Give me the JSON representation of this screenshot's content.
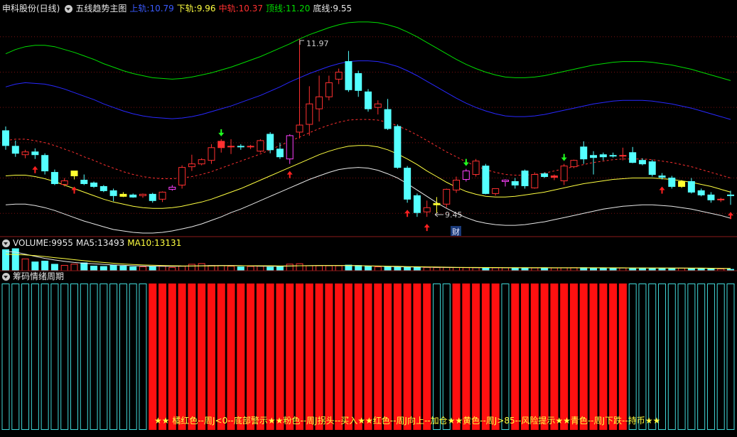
{
  "header_main": {
    "stock": "申科股份(日线)",
    "indicator": "五线趋势主图",
    "upper_label": "上轨:",
    "upper_value": "10.79",
    "lower_label": "下轨:",
    "lower_value": "9.96",
    "mid_label": "中轨:",
    "mid_value": "10.37",
    "top_label": "顶线:",
    "top_value": "11.20",
    "bottom_label": "底线:",
    "bottom_value": "9.55"
  },
  "header_volume": {
    "vol_label": "VOLUME:",
    "vol_value": "9955",
    "ma5_label": "MA5:",
    "ma5_value": "13493",
    "ma10_label": "MA10:",
    "ma10_value": "13131"
  },
  "header_chip": {
    "title": "筹码情绪周期"
  },
  "annotations": {
    "high": "11.97",
    "low": "9.45",
    "cai": "财"
  },
  "legend_text": "★★ 橘红色--周J<0--底部警示★★粉色--周J拐头--买入★★红色--周J向上--加仓★★黄色--周J>85--风险提示★★青色--周J下跌--持币★★",
  "colors": {
    "up": "#ff3030",
    "down": "#54ffff",
    "top_line": "#00dd00",
    "upper_line": "#2828ff",
    "mid_line": "#ff3030",
    "lower_line": "#ffff40",
    "bottom_line": "#e8e8e8"
  },
  "chart_data": {
    "type": "candlestick",
    "price_ylim": [
      9.2,
      12.3
    ],
    "candles": [
      {
        "o": 10.67,
        "h": 10.73,
        "l": 10.4,
        "c": 10.46,
        "mark": "down"
      },
      {
        "o": 10.45,
        "h": 10.53,
        "l": 10.3,
        "c": 10.35,
        "mark": "down"
      },
      {
        "o": 10.33,
        "h": 10.4,
        "l": 10.28,
        "c": 10.37,
        "mark": "up"
      },
      {
        "o": 10.37,
        "h": 10.42,
        "l": 10.27,
        "c": 10.33,
        "mark": "down"
      },
      {
        "o": 10.32,
        "h": 10.35,
        "l": 10.05,
        "c": 10.1,
        "mark": "down"
      },
      {
        "o": 10.08,
        "h": 10.12,
        "l": 9.9,
        "c": 9.92,
        "mark": "down"
      },
      {
        "o": 9.91,
        "h": 10.0,
        "l": 9.88,
        "c": 9.96,
        "mark": "up"
      },
      {
        "o": 10.03,
        "h": 10.1,
        "l": 9.98,
        "c": 10.1,
        "mark": "yellow"
      },
      {
        "o": 9.97,
        "h": 10.05,
        "l": 9.9,
        "c": 9.92,
        "mark": "down"
      },
      {
        "o": 9.93,
        "h": 9.95,
        "l": 9.86,
        "c": 9.88,
        "mark": "down"
      },
      {
        "o": 9.88,
        "h": 9.9,
        "l": 9.8,
        "c": 9.82,
        "mark": "down"
      },
      {
        "o": 9.82,
        "h": 9.85,
        "l": 9.67,
        "c": 9.75,
        "mark": "down"
      },
      {
        "o": 9.77,
        "h": 9.8,
        "l": 9.73,
        "c": 9.74,
        "mark": "yellow"
      },
      {
        "o": 9.76,
        "h": 9.78,
        "l": 9.72,
        "c": 9.73,
        "mark": "down"
      },
      {
        "o": 9.75,
        "h": 9.78,
        "l": 9.72,
        "c": 9.77,
        "mark": "up"
      },
      {
        "o": 9.77,
        "h": 9.79,
        "l": 9.65,
        "c": 9.68,
        "mark": "down"
      },
      {
        "o": 9.7,
        "h": 9.81,
        "l": 9.66,
        "c": 9.8,
        "mark": "up"
      },
      {
        "o": 9.84,
        "h": 9.9,
        "l": 9.82,
        "c": 9.87,
        "mark": "pink"
      },
      {
        "o": 9.9,
        "h": 10.18,
        "l": 9.85,
        "c": 10.15,
        "mark": "up"
      },
      {
        "o": 10.16,
        "h": 10.33,
        "l": 10.1,
        "c": 10.2,
        "mark": "up"
      },
      {
        "o": 10.2,
        "h": 10.28,
        "l": 10.18,
        "c": 10.26,
        "mark": "up"
      },
      {
        "o": 10.25,
        "h": 10.48,
        "l": 10.2,
        "c": 10.43,
        "mark": "up"
      },
      {
        "o": 10.43,
        "h": 10.55,
        "l": 10.36,
        "c": 10.52,
        "mark": "down"
      },
      {
        "o": 10.44,
        "h": 10.55,
        "l": 10.34,
        "c": 10.45,
        "mark": "up"
      },
      {
        "o": 10.45,
        "h": 10.48,
        "l": 10.4,
        "c": 10.44,
        "mark": "down"
      },
      {
        "o": 10.44,
        "h": 10.47,
        "l": 10.41,
        "c": 10.45,
        "mark": "up"
      },
      {
        "o": 10.38,
        "h": 10.55,
        "l": 10.36,
        "c": 10.53,
        "mark": "up"
      },
      {
        "o": 10.62,
        "h": 10.65,
        "l": 10.35,
        "c": 10.4,
        "mark": "down"
      },
      {
        "o": 10.41,
        "h": 10.5,
        "l": 10.27,
        "c": 10.3,
        "mark": "down"
      },
      {
        "o": 10.27,
        "h": 10.62,
        "l": 10.2,
        "c": 10.6,
        "mark": "pink"
      },
      {
        "o": 10.65,
        "h": 11.97,
        "l": 10.56,
        "c": 10.75,
        "mark": "up"
      },
      {
        "o": 10.76,
        "h": 11.3,
        "l": 10.6,
        "c": 11.05,
        "mark": "up"
      },
      {
        "o": 10.98,
        "h": 11.45,
        "l": 10.8,
        "c": 11.15,
        "mark": "up"
      },
      {
        "o": 11.15,
        "h": 11.45,
        "l": 11.1,
        "c": 11.35,
        "mark": "up"
      },
      {
        "o": 11.4,
        "h": 11.55,
        "l": 11.33,
        "c": 11.5,
        "mark": "up"
      },
      {
        "o": 11.65,
        "h": 11.8,
        "l": 11.22,
        "c": 11.25,
        "mark": "down"
      },
      {
        "o": 11.48,
        "h": 11.52,
        "l": 11.15,
        "c": 11.24,
        "mark": "down"
      },
      {
        "o": 11.22,
        "h": 11.26,
        "l": 10.94,
        "c": 10.98,
        "mark": "down"
      },
      {
        "o": 11.0,
        "h": 11.1,
        "l": 10.9,
        "c": 11.05,
        "mark": "up"
      },
      {
        "o": 10.97,
        "h": 11.12,
        "l": 10.68,
        "c": 10.7,
        "mark": "down"
      },
      {
        "o": 10.73,
        "h": 10.76,
        "l": 10.13,
        "c": 10.15,
        "mark": "down"
      },
      {
        "o": 10.14,
        "h": 10.17,
        "l": 9.65,
        "c": 9.7,
        "mark": "down"
      },
      {
        "o": 9.75,
        "h": 9.78,
        "l": 9.45,
        "c": 9.51,
        "mark": "down"
      },
      {
        "o": 9.52,
        "h": 9.68,
        "l": 9.45,
        "c": 9.58,
        "mark": "up"
      },
      {
        "o": 9.62,
        "h": 9.73,
        "l": 9.5,
        "c": 9.64,
        "mark": "yellow"
      },
      {
        "o": 9.63,
        "h": 9.85,
        "l": 9.58,
        "c": 9.84,
        "mark": "up"
      },
      {
        "o": 9.83,
        "h": 10.02,
        "l": 9.79,
        "c": 9.97,
        "mark": "up"
      },
      {
        "o": 9.98,
        "h": 10.13,
        "l": 9.95,
        "c": 10.1,
        "mark": "pink"
      },
      {
        "o": 10.05,
        "h": 10.27,
        "l": 10.02,
        "c": 10.24,
        "mark": "up"
      },
      {
        "o": 10.17,
        "h": 10.2,
        "l": 9.77,
        "c": 9.78,
        "mark": "down"
      },
      {
        "o": 9.78,
        "h": 9.85,
        "l": 9.75,
        "c": 9.85,
        "mark": "up"
      },
      {
        "o": 9.95,
        "h": 9.98,
        "l": 9.88,
        "c": 9.97,
        "mark": "pink"
      },
      {
        "o": 9.95,
        "h": 10.0,
        "l": 9.85,
        "c": 9.9,
        "mark": "down"
      },
      {
        "o": 10.1,
        "h": 10.12,
        "l": 9.85,
        "c": 9.89,
        "mark": "down"
      },
      {
        "o": 9.86,
        "h": 10.08,
        "l": 9.85,
        "c": 10.05,
        "mark": "up"
      },
      {
        "o": 10.06,
        "h": 10.08,
        "l": 10.0,
        "c": 10.02,
        "mark": "down"
      },
      {
        "o": 10.01,
        "h": 10.05,
        "l": 9.97,
        "c": 10.03,
        "mark": "down"
      },
      {
        "o": 9.96,
        "h": 10.2,
        "l": 9.9,
        "c": 10.17,
        "mark": "up"
      },
      {
        "o": 10.16,
        "h": 10.26,
        "l": 10.14,
        "c": 10.25,
        "mark": "up"
      },
      {
        "o": 10.44,
        "h": 10.52,
        "l": 10.2,
        "c": 10.27,
        "mark": "down"
      },
      {
        "o": 10.32,
        "h": 10.38,
        "l": 10.05,
        "c": 10.29,
        "mark": "down"
      },
      {
        "o": 10.33,
        "h": 10.36,
        "l": 10.25,
        "c": 10.3,
        "mark": "down"
      },
      {
        "o": 10.32,
        "h": 10.36,
        "l": 10.29,
        "c": 10.31,
        "mark": "down"
      },
      {
        "o": 10.32,
        "h": 10.43,
        "l": 10.25,
        "c": 10.32,
        "mark": "up"
      },
      {
        "o": 10.36,
        "h": 10.44,
        "l": 10.21,
        "c": 10.22,
        "mark": "down"
      },
      {
        "o": 10.25,
        "h": 10.28,
        "l": 10.18,
        "c": 10.2,
        "mark": "down"
      },
      {
        "o": 10.23,
        "h": 10.26,
        "l": 10.02,
        "c": 10.05,
        "mark": "down"
      },
      {
        "o": 10.03,
        "h": 10.07,
        "l": 9.98,
        "c": 10.01,
        "mark": "down"
      },
      {
        "o": 10.0,
        "h": 10.03,
        "l": 9.85,
        "c": 9.88,
        "mark": "down"
      },
      {
        "o": 9.88,
        "h": 9.97,
        "l": 9.86,
        "c": 9.95,
        "mark": "yellow"
      },
      {
        "o": 9.95,
        "h": 10.0,
        "l": 9.78,
        "c": 9.8,
        "mark": "down"
      },
      {
        "o": 9.82,
        "h": 9.85,
        "l": 9.74,
        "c": 9.76,
        "mark": "down"
      },
      {
        "o": 9.76,
        "h": 9.8,
        "l": 9.65,
        "c": 9.69,
        "mark": "down"
      },
      {
        "o": 9.69,
        "h": 9.72,
        "l": 9.66,
        "c": 9.7,
        "mark": "up"
      },
      {
        "o": 9.76,
        "h": 9.82,
        "l": 9.62,
        "c": 9.75,
        "mark": "up"
      }
    ],
    "bands": {
      "top": [
        11.76,
        11.82,
        11.86,
        11.88,
        11.88,
        11.86,
        11.82,
        11.78,
        11.73,
        11.68,
        11.62,
        11.57,
        11.52,
        11.48,
        11.45,
        11.42,
        11.41,
        11.4,
        11.41,
        11.43,
        11.46,
        11.49,
        11.53,
        11.57,
        11.62,
        11.67,
        11.72,
        11.78,
        11.84,
        11.9,
        11.97,
        12.03,
        12.08,
        12.13,
        12.17,
        12.2,
        12.21,
        12.21,
        12.2,
        12.17,
        12.13,
        12.07,
        12.0,
        11.92,
        11.84,
        11.76,
        11.68,
        11.61,
        11.55,
        11.5,
        11.46,
        11.43,
        11.42,
        11.42,
        11.43,
        11.45,
        11.48,
        11.51,
        11.54,
        11.57,
        11.6,
        11.62,
        11.64,
        11.65,
        11.65,
        11.65,
        11.64,
        11.62,
        11.6,
        11.57,
        11.54,
        11.5,
        11.46,
        11.42,
        11.38
      ],
      "upper": [
        11.29,
        11.33,
        11.35,
        11.34,
        11.33,
        11.3,
        11.26,
        11.21,
        11.16,
        11.11,
        11.05,
        11.0,
        10.95,
        10.91,
        10.88,
        10.86,
        10.85,
        10.84,
        10.85,
        10.87,
        10.9,
        10.94,
        10.98,
        11.02,
        11.07,
        11.12,
        11.17,
        11.23,
        11.29,
        11.36,
        11.42,
        11.48,
        11.53,
        11.58,
        11.62,
        11.65,
        11.66,
        11.66,
        11.65,
        11.62,
        11.58,
        11.52,
        11.45,
        11.37,
        11.29,
        11.21,
        11.13,
        11.06,
        11.0,
        10.95,
        10.91,
        10.88,
        10.87,
        10.87,
        10.88,
        10.9,
        10.93,
        10.96,
        10.99,
        11.02,
        11.05,
        11.07,
        11.09,
        11.1,
        11.1,
        11.1,
        11.09,
        11.07,
        11.05,
        11.02,
        10.99,
        10.95,
        10.91,
        10.87,
        10.83
      ],
      "mid": [
        10.53,
        10.55,
        10.55,
        10.53,
        10.5,
        10.46,
        10.41,
        10.36,
        10.3,
        10.25,
        10.19,
        10.14,
        10.09,
        10.05,
        10.02,
        10.0,
        9.99,
        9.99,
        10.0,
        10.02,
        10.05,
        10.09,
        10.14,
        10.19,
        10.24,
        10.29,
        10.34,
        10.4,
        10.46,
        10.52,
        10.58,
        10.64,
        10.7,
        10.75,
        10.79,
        10.82,
        10.83,
        10.83,
        10.82,
        10.79,
        10.74,
        10.68,
        10.61,
        10.53,
        10.45,
        10.37,
        10.3,
        10.23,
        10.17,
        10.12,
        10.08,
        10.05,
        10.04,
        10.04,
        10.05,
        10.07,
        10.1,
        10.13,
        10.16,
        10.19,
        10.22,
        10.24,
        10.26,
        10.27,
        10.27,
        10.27,
        10.26,
        10.24,
        10.22,
        10.19,
        10.16,
        10.12,
        10.08,
        10.04,
        10.0
      ],
      "lower": [
        10.03,
        10.04,
        10.04,
        10.02,
        9.99,
        9.95,
        9.9,
        9.85,
        9.8,
        9.75,
        9.7,
        9.66,
        9.63,
        9.6,
        9.58,
        9.57,
        9.57,
        9.58,
        9.6,
        9.63,
        9.66,
        9.7,
        9.75,
        9.8,
        9.85,
        9.91,
        9.97,
        10.03,
        10.09,
        10.15,
        10.21,
        10.27,
        10.33,
        10.38,
        10.42,
        10.45,
        10.46,
        10.46,
        10.44,
        10.4,
        10.34,
        10.27,
        10.19,
        10.1,
        10.02,
        9.94,
        9.87,
        9.81,
        9.77,
        9.74,
        9.73,
        9.73,
        9.74,
        9.76,
        9.78,
        9.8,
        9.83,
        9.86,
        9.89,
        9.92,
        9.94,
        9.96,
        9.98,
        9.99,
        10.0,
        10.0,
        10.0,
        9.99,
        9.98,
        9.96,
        9.94,
        9.91,
        9.88,
        9.84,
        9.8
      ],
      "bottom": [
        9.62,
        9.63,
        9.63,
        9.61,
        9.58,
        9.54,
        9.49,
        9.44,
        9.39,
        9.35,
        9.31,
        9.27,
        9.25,
        9.23,
        9.22,
        9.22,
        9.23,
        9.25,
        9.28,
        9.31,
        9.35,
        9.4,
        9.45,
        9.51,
        9.56,
        9.62,
        9.68,
        9.74,
        9.8,
        9.86,
        9.92,
        9.98,
        10.03,
        10.08,
        10.12,
        10.14,
        10.15,
        10.14,
        10.11,
        10.06,
        10.0,
        9.92,
        9.83,
        9.74,
        9.65,
        9.57,
        9.5,
        9.44,
        9.39,
        9.36,
        9.34,
        9.33,
        9.33,
        9.34,
        9.36,
        9.38,
        9.41,
        9.44,
        9.47,
        9.5,
        9.53,
        9.56,
        9.58,
        9.6,
        9.61,
        9.62,
        9.62,
        9.61,
        9.6,
        9.58,
        9.56,
        9.53,
        9.5,
        9.47,
        9.43
      ]
    },
    "signals": {
      "buy_red": [
        3,
        7,
        29,
        41,
        43,
        67,
        74
      ],
      "sell_green": [
        22,
        47,
        57
      ]
    },
    "volume": {
      "values": [
        15.3,
        16.0,
        8.6,
        6.4,
        7.0,
        4.7,
        3.9,
        4.8,
        5.7,
        3.4,
        3.1,
        3.9,
        3.4,
        2.8,
        2.9,
        3.1,
        3.3,
        2.4,
        3.3,
        4.7,
        5.2,
        3.8,
        3.7,
        3.3,
        2.8,
        3.1,
        3.3,
        2.6,
        3.0,
        4.8,
        5.1,
        3.6,
        3.6,
        3.6,
        3.6,
        4.1,
        3.8,
        3.1,
        2.8,
        2.7,
        2.5,
        2.6,
        2.5,
        2.4,
        2.3,
        2.3,
        2.3,
        2.2,
        2.2,
        2.1,
        2.1,
        2.1,
        2.1,
        2.1,
        2.0,
        2.1,
        2.0,
        2.1,
        2.2,
        2.2,
        2.0,
        2.0,
        1.9,
        2.0,
        1.9,
        2.0,
        1.8,
        1.8,
        1.8,
        1.8,
        1.7,
        1.8,
        1.5,
        1.3,
        1.0
      ],
      "ma5": [
        14.0,
        13.5,
        12.0,
        10.5,
        9.0,
        7.8,
        6.8,
        6.0,
        5.4,
        5.0,
        4.6,
        4.2,
        3.9,
        3.6,
        3.4,
        3.3,
        3.2,
        3.2,
        3.3,
        3.4,
        3.6,
        3.7,
        3.8,
        3.8,
        3.7,
        3.5,
        3.3,
        3.2,
        3.2,
        3.4,
        3.6,
        3.7,
        3.8,
        3.8,
        3.8,
        3.8,
        3.7,
        3.5,
        3.3,
        3.1,
        2.9,
        2.8,
        2.7,
        2.6,
        2.5,
        2.4,
        2.3,
        2.3,
        2.2,
        2.2,
        2.2,
        2.2,
        2.1,
        2.1,
        2.1,
        2.1,
        2.1,
        2.1,
        2.1,
        2.1,
        2.1,
        2.1,
        2.0,
        2.0,
        2.0,
        2.0,
        1.9,
        1.9,
        1.9,
        1.9,
        1.8,
        1.8,
        1.7,
        1.6,
        1.5
      ],
      "ma10": [
        12.0,
        11.8,
        11.5,
        11.0,
        10.3,
        9.5,
        8.8,
        8.0,
        7.3,
        6.6,
        6.0,
        5.4,
        4.9,
        4.5,
        4.2,
        4.0,
        3.8,
        3.6,
        3.5,
        3.5,
        3.5,
        3.5,
        3.6,
        3.6,
        3.6,
        3.6,
        3.6,
        3.6,
        3.5,
        3.5,
        3.6,
        3.6,
        3.7,
        3.7,
        3.7,
        3.7,
        3.6,
        3.5,
        3.4,
        3.3,
        3.2,
        3.0,
        2.9,
        2.8,
        2.7,
        2.6,
        2.5,
        2.4,
        2.4,
        2.3,
        2.3,
        2.2,
        2.2,
        2.2,
        2.2,
        2.2,
        2.1,
        2.1,
        2.1,
        2.1,
        2.1,
        2.1,
        2.1,
        2.1,
        2.0,
        2.0,
        2.0,
        2.0,
        1.9,
        1.9,
        1.9,
        1.9,
        1.8,
        1.7,
        1.7
      ]
    },
    "chip_cycle": [
      "cyan",
      "cyan",
      "cyan",
      "cyan",
      "cyan",
      "cyan",
      "cyan",
      "cyan",
      "cyan",
      "cyan",
      "cyan",
      "cyan",
      "cyan",
      "cyan",
      "cyan",
      "red",
      "red",
      "red",
      "red",
      "red",
      "red",
      "red",
      "red",
      "red",
      "red",
      "red",
      "red",
      "red",
      "red",
      "red",
      "red",
      "red",
      "red",
      "red",
      "red",
      "red",
      "red",
      "red",
      "red",
      "red",
      "red",
      "red",
      "red",
      "red",
      "cyan",
      "cyan",
      "red",
      "red",
      "red",
      "red",
      "red",
      "cyan",
      "red",
      "red",
      "red",
      "red",
      "red",
      "red",
      "red",
      "red",
      "red",
      "red",
      "red",
      "red",
      "cyan",
      "cyan",
      "cyan",
      "cyan",
      "cyan",
      "cyan",
      "cyan",
      "cyan",
      "cyan",
      "cyan",
      "cyan"
    ]
  }
}
